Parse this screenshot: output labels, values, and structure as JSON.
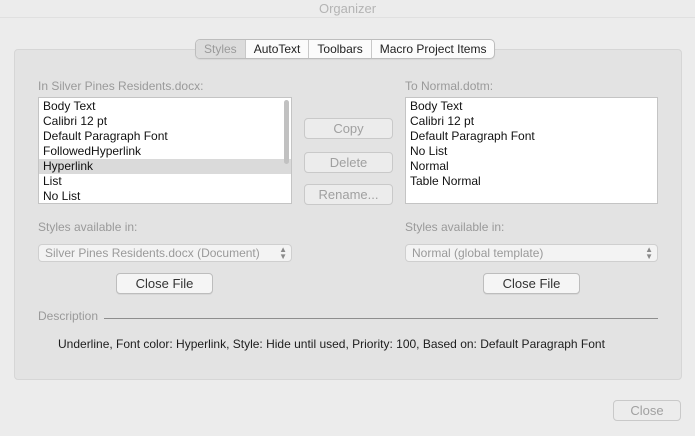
{
  "window": {
    "title": "Organizer"
  },
  "tabs": [
    {
      "label": "Styles"
    },
    {
      "label": "AutoText"
    },
    {
      "label": "Toolbars"
    },
    {
      "label": "Macro Project Items"
    }
  ],
  "left": {
    "label": "In Silver Pines Residents.docx:",
    "items": [
      "Body Text",
      "Calibri 12 pt",
      "Default Paragraph Font",
      "FollowedHyperlink",
      "Hyperlink",
      "List",
      "No List"
    ],
    "selected_item": "Hyperlink",
    "styles_available_label": "Styles available in:",
    "styles_available_value": "Silver Pines Residents.docx (Document)",
    "close_file_label": "Close File"
  },
  "right": {
    "label": "To Normal.dotm:",
    "items": [
      "Body Text",
      "Calibri 12 pt",
      "Default Paragraph Font",
      "No List",
      "Normal",
      "Table Normal"
    ],
    "styles_available_label": "Styles available in:",
    "styles_available_value": "Normal (global template)",
    "close_file_label": "Close File"
  },
  "actions": {
    "copy": "Copy",
    "delete": "Delete",
    "rename": "Rename..."
  },
  "description": {
    "label": "Description",
    "text": "Underline, Font color: Hyperlink, Style: Hide until used, Priority: 100, Based on: Default Paragraph Font"
  },
  "footer": {
    "close": "Close"
  },
  "icons": {
    "select_chevron": "chevron-updown-icon"
  }
}
